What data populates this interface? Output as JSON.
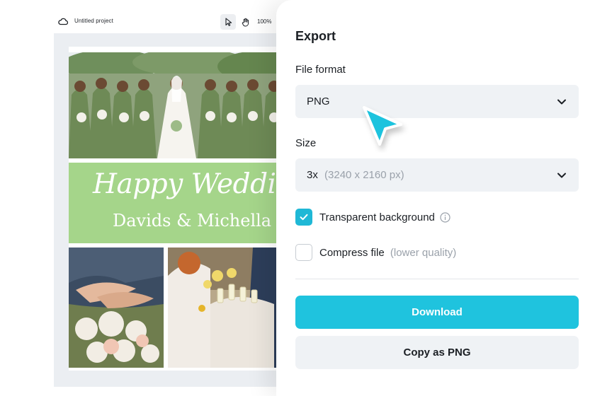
{
  "editor": {
    "project_title": "Untitled project",
    "zoom": "100%",
    "tools": [
      "pointer-icon",
      "hand-icon"
    ],
    "design": {
      "title": "Happy Wedding",
      "names": "Davids & Michella",
      "banner_color": "#a5d58a"
    }
  },
  "export_panel": {
    "title": "Export",
    "file_format_label": "File format",
    "file_format_value": "PNG",
    "size_label": "Size",
    "size_value": "3x",
    "size_detail": "(3240 x 2160 px)",
    "transparent_label": "Transparent background",
    "transparent_checked": true,
    "compress_label": "Compress file",
    "compress_detail": "(lower quality)",
    "compress_checked": false,
    "download_label": "Download",
    "copy_label": "Copy as PNG",
    "accent_color": "#1fc3de"
  }
}
